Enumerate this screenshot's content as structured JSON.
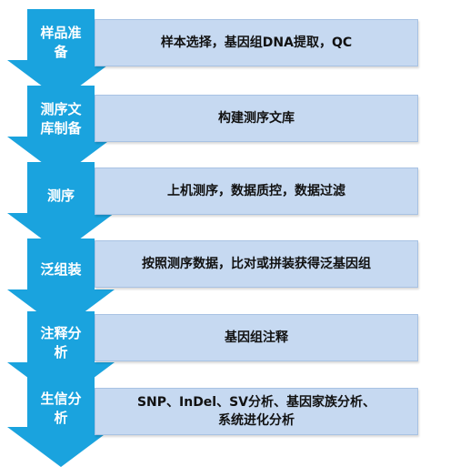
{
  "colors": {
    "arrow_fill": "#1aa3de",
    "box_fill": "#c6d9f1",
    "box_border": "#a8c2e3"
  },
  "steps": [
    {
      "label": "样品准\n备",
      "description": "样本选择，基因组DNA提取，QC"
    },
    {
      "label": "测序文\n库制备",
      "description": "构建测序文库"
    },
    {
      "label": "测序",
      "description": "上机测序，数据质控，数据过滤"
    },
    {
      "label": "泛组装",
      "description": "按照测序数据，比对或拼装获得泛基因组"
    },
    {
      "label": "注释分\n析",
      "description": "基因组注释"
    },
    {
      "label": "生信分\n析",
      "description": "SNP、InDel、SV分析、基因家族分析、\n系统进化分析"
    }
  ]
}
